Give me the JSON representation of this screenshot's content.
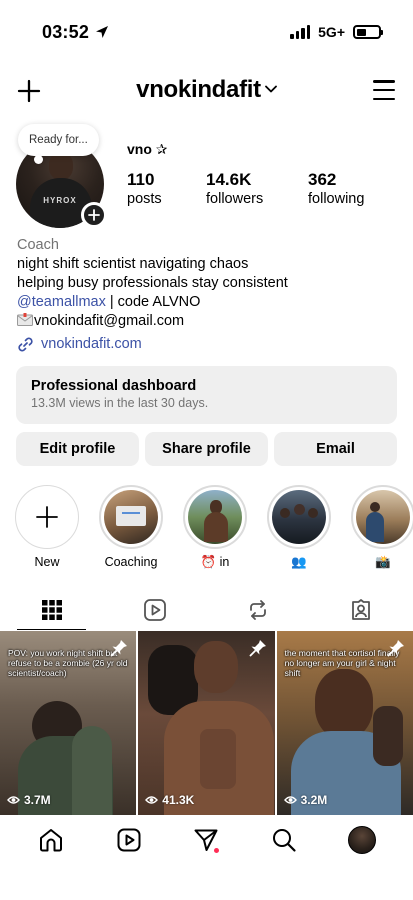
{
  "status": {
    "time": "03:52",
    "network": "5G+",
    "battery_level": 0.45
  },
  "header": {
    "username": "vnokindafit"
  },
  "profile": {
    "note": "Ready for...",
    "name": "vno ✰",
    "shirt_logo": "HYROX",
    "stats": [
      {
        "value": "110",
        "label": "posts"
      },
      {
        "value": "14.6K",
        "label": "followers"
      },
      {
        "value": "362",
        "label": "following"
      }
    ],
    "category": "Coach",
    "bio_line1": "night shift scientist navigating chaos",
    "bio_line2": "helping busy professionals stay consistent",
    "bio_tag": "@teamallmax",
    "bio_code": " | code ALVNO",
    "email": "vnokindafit@gmail.com",
    "link": "vnokindafit.com"
  },
  "dashboard": {
    "title": "Professional dashboard",
    "subtitle": "13.3M views in the last 30 days."
  },
  "actions": {
    "edit": "Edit profile",
    "share": "Share profile",
    "email": "Email"
  },
  "highlights": [
    {
      "label": "New"
    },
    {
      "label": "Coaching"
    },
    {
      "label": "⏰ in"
    },
    {
      "label": "👥"
    },
    {
      "label": "📸"
    }
  ],
  "posts": [
    {
      "caption": "POV: you work night shift but refuse to be a zombie (26 yr old scientist/coach)",
      "views": "3.7M"
    },
    {
      "caption": "",
      "views": "41.3K"
    },
    {
      "caption": "the moment that cortisol finally no longer am your girl & night shift",
      "views": "3.2M"
    }
  ],
  "colors": {
    "link": "#3c52a6",
    "secondary": "#737373",
    "button_bg": "#efefef",
    "dm_badge": "#ff2d55"
  }
}
